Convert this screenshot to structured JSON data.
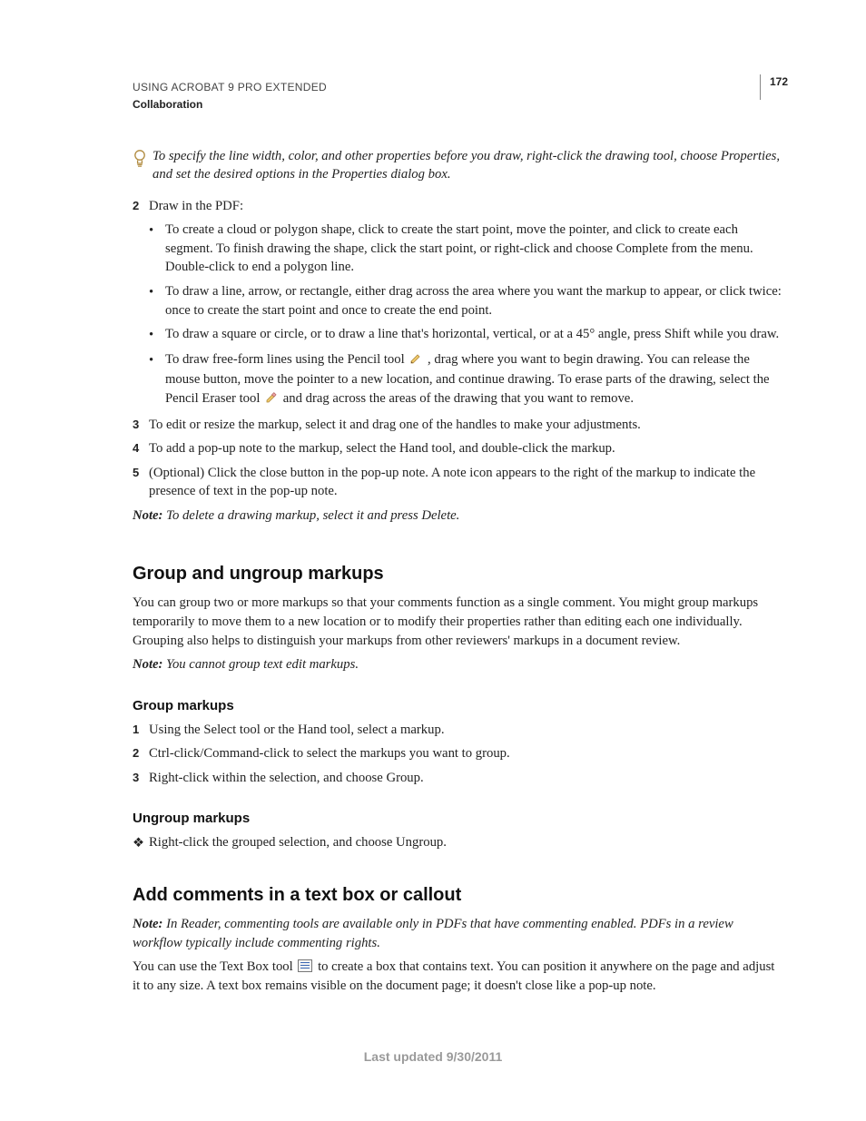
{
  "header": {
    "running": "USING ACROBAT 9 PRO EXTENDED",
    "section": "Collaboration",
    "page_number": "172"
  },
  "tip": "To specify the line width, color, and other properties before you draw, right-click the drawing tool, choose Properties, and set the desired options in the Properties dialog box.",
  "steps_a": {
    "s2": "Draw in the PDF:",
    "b1": "To create a cloud or polygon shape, click to create the start point, move the pointer, and click to create each segment. To finish drawing the shape, click the start point, or right-click and choose Complete from the menu. Double-click to end a polygon line.",
    "b2": "To draw a line, arrow, or rectangle, either drag across the area where you want the markup to appear, or click twice: once to create the start point and once to create the end point.",
    "b3": "To draw a square or circle, or to draw a line that's horizontal, vertical, or at a 45° angle, press Shift while you draw.",
    "b4a": "To draw free-form lines using the Pencil tool ",
    "b4b": ", drag where you want to begin drawing. You can release the mouse button, move the pointer to a new location, and continue drawing. To erase parts of the drawing, select the Pencil Eraser tool ",
    "b4c": " and drag across the areas of the drawing that you want to remove.",
    "s3": "To edit or resize the markup, select it and drag one of the handles to make your adjustments.",
    "s4": "To add a pop-up note to the markup, select the Hand tool, and double-click the markup.",
    "s5": "(Optional) Click the close button in the pop-up note. A note icon appears to the right of the markup to indicate the presence of text in the pop-up note."
  },
  "note1": {
    "label": "Note:",
    "body": " To delete a drawing markup, select it and press Delete."
  },
  "section1": {
    "title": "Group and ungroup markups",
    "para": "You can group two or more markups so that your comments function as a single comment. You might group markups temporarily to move them to a new location or to modify their properties rather than editing each one individually. Grouping also helps to distinguish your markups from other reviewers' markups in a document review.",
    "note_label": "Note:",
    "note_body": " You cannot group text edit markups."
  },
  "group": {
    "title": "Group markups",
    "s1": "Using the Select tool or the Hand tool, select a markup.",
    "s2": "Ctrl-click/Command-click to select the markups you want to group.",
    "s3": "Right-click within the selection, and choose Group."
  },
  "ungroup": {
    "title": "Ungroup markups",
    "d1": "Right-click the grouped selection, and choose Ungroup."
  },
  "section2": {
    "title": "Add comments in a text box or callout",
    "note_label": "Note:",
    "note_body": " In Reader, commenting tools are available only in PDFs that have commenting enabled. PDFs in a review workflow typically include commenting rights.",
    "para_a": "You can use the Text Box tool ",
    "para_b": " to create a box that contains text. You can position it anywhere on the page and adjust it to any size. A text box remains visible on the document page; it doesn't close like a pop-up note."
  },
  "footer": "Last updated 9/30/2011",
  "markers": {
    "n2": "2",
    "n3": "3",
    "n4": "4",
    "n5": "5",
    "n1": "1",
    "bullet": "•",
    "diamond": "❖"
  }
}
